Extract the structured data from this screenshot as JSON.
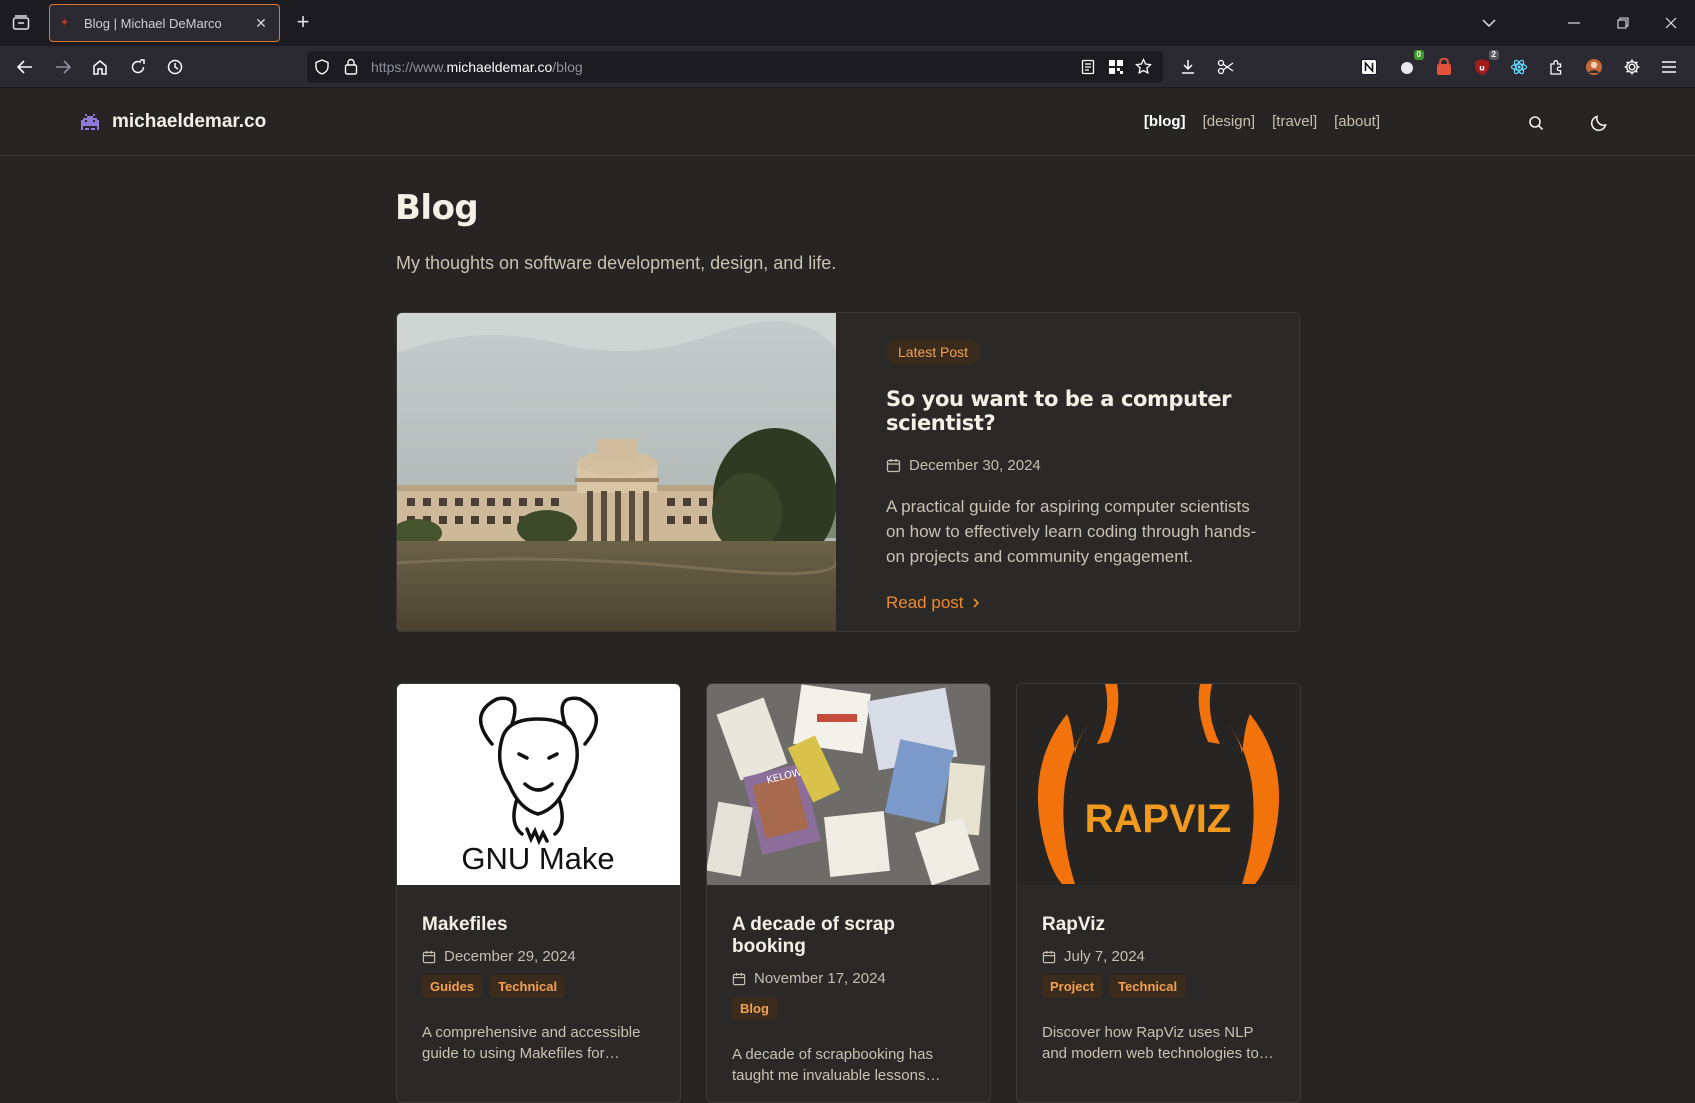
{
  "browser": {
    "tab_title": "Blog | Michael DeMarco",
    "url_prefix": "https://www.",
    "url_host": "michaeldemar.co",
    "url_path": "/blog",
    "ext_badge_green": "0",
    "ext_badge_gray": "2"
  },
  "site": {
    "name": "michaeldemar.co",
    "nav": [
      "[blog]",
      "[design]",
      "[travel]",
      "[about]"
    ]
  },
  "page": {
    "title": "Blog",
    "subtitle": "My thoughts on software development, design, and life."
  },
  "featured": {
    "badge": "Latest Post",
    "title": "So you want to be a computer scientist?",
    "date": "December 30, 2024",
    "description": "A practical guide for aspiring computer scientists on how to effectively learn coding through hands-on projects and community engagement.",
    "link": "Read post"
  },
  "posts": [
    {
      "title": "Makefiles",
      "date": "December 29, 2024",
      "tags": [
        "Guides",
        "Technical"
      ],
      "description": "A comprehensive and accessible guide to using Makefiles for…",
      "image_text": "GNU Make"
    },
    {
      "title": "A decade of scrap booking",
      "date": "November 17, 2024",
      "tags": [
        "Blog"
      ],
      "description": "A decade of scrapbooking has taught me invaluable lessons…",
      "image_text": "KELOWNA"
    },
    {
      "title": "RapViz",
      "date": "July 7, 2024",
      "tags": [
        "Project",
        "Technical"
      ],
      "description": "Discover how RapViz uses NLP and modern web technologies to…",
      "image_text": "RAPVIZ"
    }
  ],
  "colors": {
    "accent": "#f08a2c",
    "background": "#262524",
    "card": "#2a2928",
    "tag_bg": "#3b2b1d"
  }
}
